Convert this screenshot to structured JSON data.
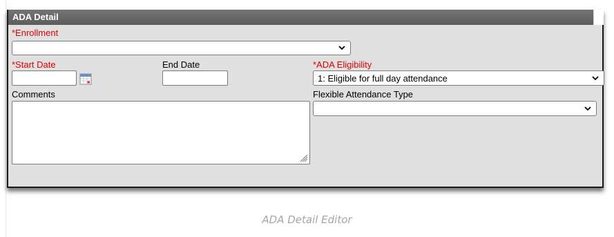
{
  "panel": {
    "title": "ADA Detail"
  },
  "fields": {
    "enrollment": {
      "label": "*Enrollment",
      "value": ""
    },
    "start_date": {
      "label": "*Start Date",
      "value": ""
    },
    "end_date": {
      "label": "End Date",
      "value": ""
    },
    "ada_eligibility": {
      "label": "*ADA Eligibility",
      "value": "1: Eligible for full day attendance"
    },
    "comments": {
      "label": "Comments",
      "value": ""
    },
    "flexible_attendance_type": {
      "label": "Flexible Attendance Type",
      "value": ""
    }
  },
  "icons": {
    "calendar": "calendar-icon",
    "dropdown": "chevron-down-icon",
    "resize": "resize-grip-icon"
  },
  "colors": {
    "required_label": "#e00000",
    "header_bg": "#666666",
    "panel_bg": "#e0e0e0"
  },
  "caption": "ADA Detail Editor"
}
